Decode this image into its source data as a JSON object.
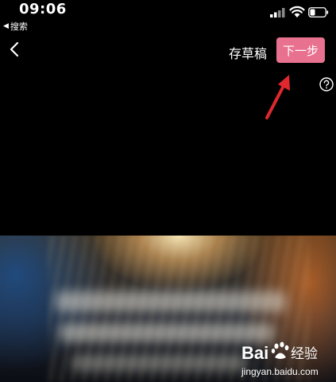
{
  "status_bar": {
    "time": "09:06",
    "back_app_label": "搜索"
  },
  "header": {
    "drafts_label": "存草稿",
    "next_label": "下一步"
  },
  "colors": {
    "next_button": "#e8718f",
    "annotation_arrow": "#e0282e",
    "background": "#000000"
  },
  "watermark": {
    "brand": "Bai",
    "brand2": "经验",
    "url": "jingyan.baidu.com"
  }
}
